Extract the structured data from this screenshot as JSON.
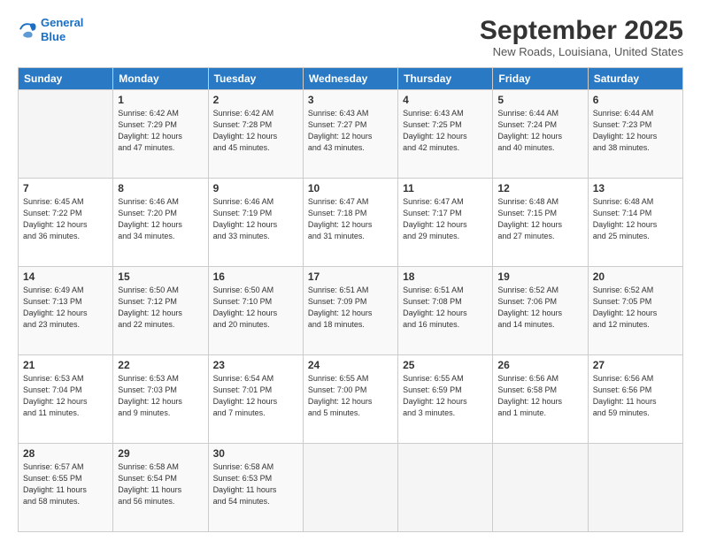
{
  "logo": {
    "line1": "General",
    "line2": "Blue"
  },
  "title": "September 2025",
  "location": "New Roads, Louisiana, United States",
  "days_header": [
    "Sunday",
    "Monday",
    "Tuesday",
    "Wednesday",
    "Thursday",
    "Friday",
    "Saturday"
  ],
  "weeks": [
    [
      {
        "day": "",
        "info": ""
      },
      {
        "day": "1",
        "info": "Sunrise: 6:42 AM\nSunset: 7:29 PM\nDaylight: 12 hours\nand 47 minutes."
      },
      {
        "day": "2",
        "info": "Sunrise: 6:42 AM\nSunset: 7:28 PM\nDaylight: 12 hours\nand 45 minutes."
      },
      {
        "day": "3",
        "info": "Sunrise: 6:43 AM\nSunset: 7:27 PM\nDaylight: 12 hours\nand 43 minutes."
      },
      {
        "day": "4",
        "info": "Sunrise: 6:43 AM\nSunset: 7:25 PM\nDaylight: 12 hours\nand 42 minutes."
      },
      {
        "day": "5",
        "info": "Sunrise: 6:44 AM\nSunset: 7:24 PM\nDaylight: 12 hours\nand 40 minutes."
      },
      {
        "day": "6",
        "info": "Sunrise: 6:44 AM\nSunset: 7:23 PM\nDaylight: 12 hours\nand 38 minutes."
      }
    ],
    [
      {
        "day": "7",
        "info": "Sunrise: 6:45 AM\nSunset: 7:22 PM\nDaylight: 12 hours\nand 36 minutes."
      },
      {
        "day": "8",
        "info": "Sunrise: 6:46 AM\nSunset: 7:20 PM\nDaylight: 12 hours\nand 34 minutes."
      },
      {
        "day": "9",
        "info": "Sunrise: 6:46 AM\nSunset: 7:19 PM\nDaylight: 12 hours\nand 33 minutes."
      },
      {
        "day": "10",
        "info": "Sunrise: 6:47 AM\nSunset: 7:18 PM\nDaylight: 12 hours\nand 31 minutes."
      },
      {
        "day": "11",
        "info": "Sunrise: 6:47 AM\nSunset: 7:17 PM\nDaylight: 12 hours\nand 29 minutes."
      },
      {
        "day": "12",
        "info": "Sunrise: 6:48 AM\nSunset: 7:15 PM\nDaylight: 12 hours\nand 27 minutes."
      },
      {
        "day": "13",
        "info": "Sunrise: 6:48 AM\nSunset: 7:14 PM\nDaylight: 12 hours\nand 25 minutes."
      }
    ],
    [
      {
        "day": "14",
        "info": "Sunrise: 6:49 AM\nSunset: 7:13 PM\nDaylight: 12 hours\nand 23 minutes."
      },
      {
        "day": "15",
        "info": "Sunrise: 6:50 AM\nSunset: 7:12 PM\nDaylight: 12 hours\nand 22 minutes."
      },
      {
        "day": "16",
        "info": "Sunrise: 6:50 AM\nSunset: 7:10 PM\nDaylight: 12 hours\nand 20 minutes."
      },
      {
        "day": "17",
        "info": "Sunrise: 6:51 AM\nSunset: 7:09 PM\nDaylight: 12 hours\nand 18 minutes."
      },
      {
        "day": "18",
        "info": "Sunrise: 6:51 AM\nSunset: 7:08 PM\nDaylight: 12 hours\nand 16 minutes."
      },
      {
        "day": "19",
        "info": "Sunrise: 6:52 AM\nSunset: 7:06 PM\nDaylight: 12 hours\nand 14 minutes."
      },
      {
        "day": "20",
        "info": "Sunrise: 6:52 AM\nSunset: 7:05 PM\nDaylight: 12 hours\nand 12 minutes."
      }
    ],
    [
      {
        "day": "21",
        "info": "Sunrise: 6:53 AM\nSunset: 7:04 PM\nDaylight: 12 hours\nand 11 minutes."
      },
      {
        "day": "22",
        "info": "Sunrise: 6:53 AM\nSunset: 7:03 PM\nDaylight: 12 hours\nand 9 minutes."
      },
      {
        "day": "23",
        "info": "Sunrise: 6:54 AM\nSunset: 7:01 PM\nDaylight: 12 hours\nand 7 minutes."
      },
      {
        "day": "24",
        "info": "Sunrise: 6:55 AM\nSunset: 7:00 PM\nDaylight: 12 hours\nand 5 minutes."
      },
      {
        "day": "25",
        "info": "Sunrise: 6:55 AM\nSunset: 6:59 PM\nDaylight: 12 hours\nand 3 minutes."
      },
      {
        "day": "26",
        "info": "Sunrise: 6:56 AM\nSunset: 6:58 PM\nDaylight: 12 hours\nand 1 minute."
      },
      {
        "day": "27",
        "info": "Sunrise: 6:56 AM\nSunset: 6:56 PM\nDaylight: 11 hours\nand 59 minutes."
      }
    ],
    [
      {
        "day": "28",
        "info": "Sunrise: 6:57 AM\nSunset: 6:55 PM\nDaylight: 11 hours\nand 58 minutes."
      },
      {
        "day": "29",
        "info": "Sunrise: 6:58 AM\nSunset: 6:54 PM\nDaylight: 11 hours\nand 56 minutes."
      },
      {
        "day": "30",
        "info": "Sunrise: 6:58 AM\nSunset: 6:53 PM\nDaylight: 11 hours\nand 54 minutes."
      },
      {
        "day": "",
        "info": ""
      },
      {
        "day": "",
        "info": ""
      },
      {
        "day": "",
        "info": ""
      },
      {
        "day": "",
        "info": ""
      }
    ]
  ]
}
